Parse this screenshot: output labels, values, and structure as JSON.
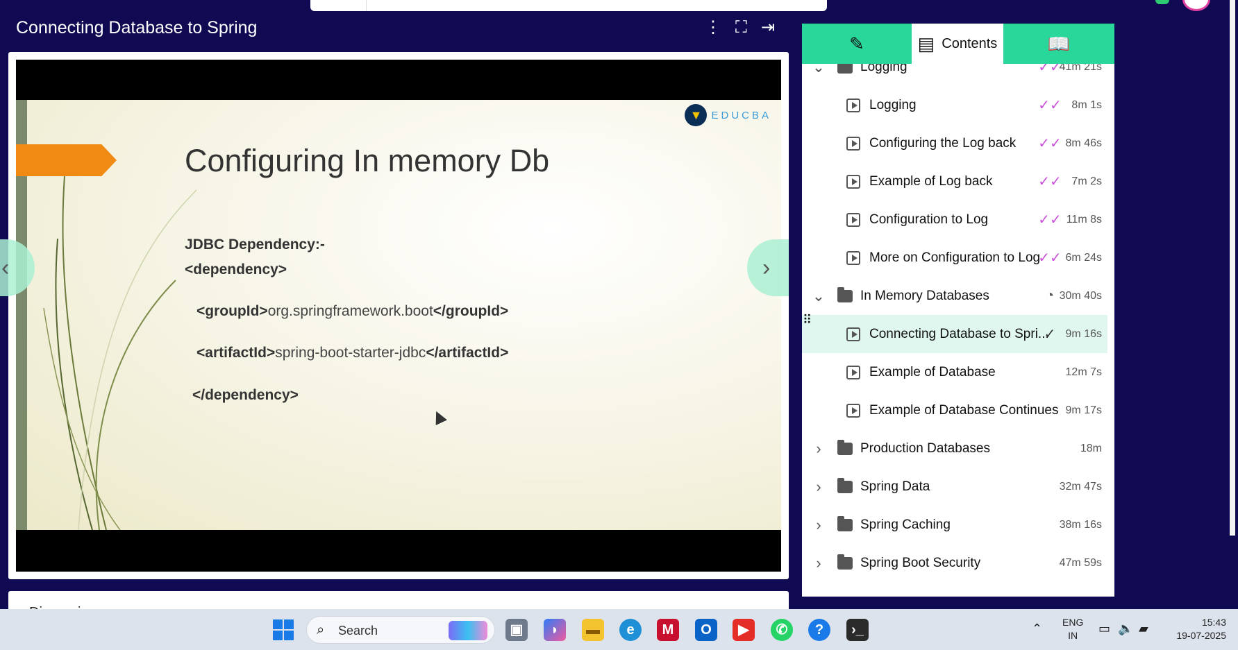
{
  "player": {
    "lesson_title": "Connecting Database to Spring",
    "controls": [
      {
        "name": "more-options",
        "glyph": "⋮"
      },
      {
        "name": "fullscreen",
        "glyph": "⛶"
      },
      {
        "name": "collapse-panel",
        "glyph": "⇥"
      }
    ],
    "slide": {
      "title": "Configuring In memory Db",
      "brand": "EDUCBA",
      "lines": [
        {
          "bold": "JDBC Dependency:-",
          "text": "",
          "bold_end": ""
        },
        {
          "bold": "<dependency>",
          "text": "",
          "bold_end": ""
        },
        {
          "bold": "<groupId>",
          "text": "org.springframework.boot",
          "bold_end": "</groupId>"
        },
        {
          "bold": "<artifactId>",
          "text": "spring-boot-starter-jdbc",
          "bold_end": "</artifactId>"
        },
        {
          "bold": "</dependency>",
          "text": "",
          "bold_end": ""
        }
      ]
    },
    "discussion_label": "Discussion"
  },
  "panel": {
    "tabs": [
      {
        "label": "",
        "icon": "ai-sparkle-icon"
      },
      {
        "label": "Contents",
        "icon": "contents-icon"
      },
      {
        "label": "",
        "icon": "book-icon"
      }
    ],
    "rows": [
      {
        "type": "section",
        "label": "Logging",
        "expanded": true,
        "status": "done",
        "duration": "41m 21s"
      },
      {
        "type": "item",
        "label": "Logging",
        "status": "done",
        "duration": "8m 1s"
      },
      {
        "type": "item",
        "label": "Configuring the Log back",
        "status": "done",
        "duration": "8m 46s"
      },
      {
        "type": "item",
        "label": "Example of Log back",
        "status": "done",
        "duration": "7m 2s"
      },
      {
        "type": "item",
        "label": "Configuration to Log",
        "status": "done",
        "duration": "11m 8s"
      },
      {
        "type": "item",
        "label": "More on Configuration to Log",
        "status": "done",
        "duration": "6m 24s"
      },
      {
        "type": "section",
        "label": "In Memory Databases",
        "expanded": true,
        "status": "partial",
        "duration": "30m 40s"
      },
      {
        "type": "item",
        "label": "Connecting Database to Spri...",
        "status": "current",
        "duration": "9m 16s",
        "active": true
      },
      {
        "type": "item",
        "label": "Example of Database",
        "status": "",
        "duration": "12m 7s"
      },
      {
        "type": "item",
        "label": "Example of Database Continues",
        "status": "",
        "duration": "9m 17s"
      },
      {
        "type": "section",
        "label": "Production Databases",
        "expanded": false,
        "status": "",
        "duration": "18m"
      },
      {
        "type": "section",
        "label": "Spring Data",
        "expanded": false,
        "status": "",
        "duration": "32m 47s"
      },
      {
        "type": "section",
        "label": "Spring Caching",
        "expanded": false,
        "status": "",
        "duration": "38m 16s"
      },
      {
        "type": "section",
        "label": "Spring Boot Security",
        "expanded": false,
        "status": "",
        "duration": "47m 59s"
      }
    ]
  },
  "taskbar": {
    "search_label": "Search",
    "apps": [
      "task-view",
      "copilot",
      "file-explorer",
      "edge",
      "mcafee",
      "outlook",
      "youtube",
      "whatsapp",
      "help",
      "terminal"
    ],
    "lang_line1": "ENG",
    "lang_line2": "IN",
    "time": "15:43",
    "date": "19-07-2025"
  },
  "colors": {
    "page_bg": "#0f0a52",
    "tab_accent": "#2ad79b",
    "done_check": "#c850d8",
    "active_row": "#dff7ee",
    "slide_arrow": "#f08a12"
  }
}
